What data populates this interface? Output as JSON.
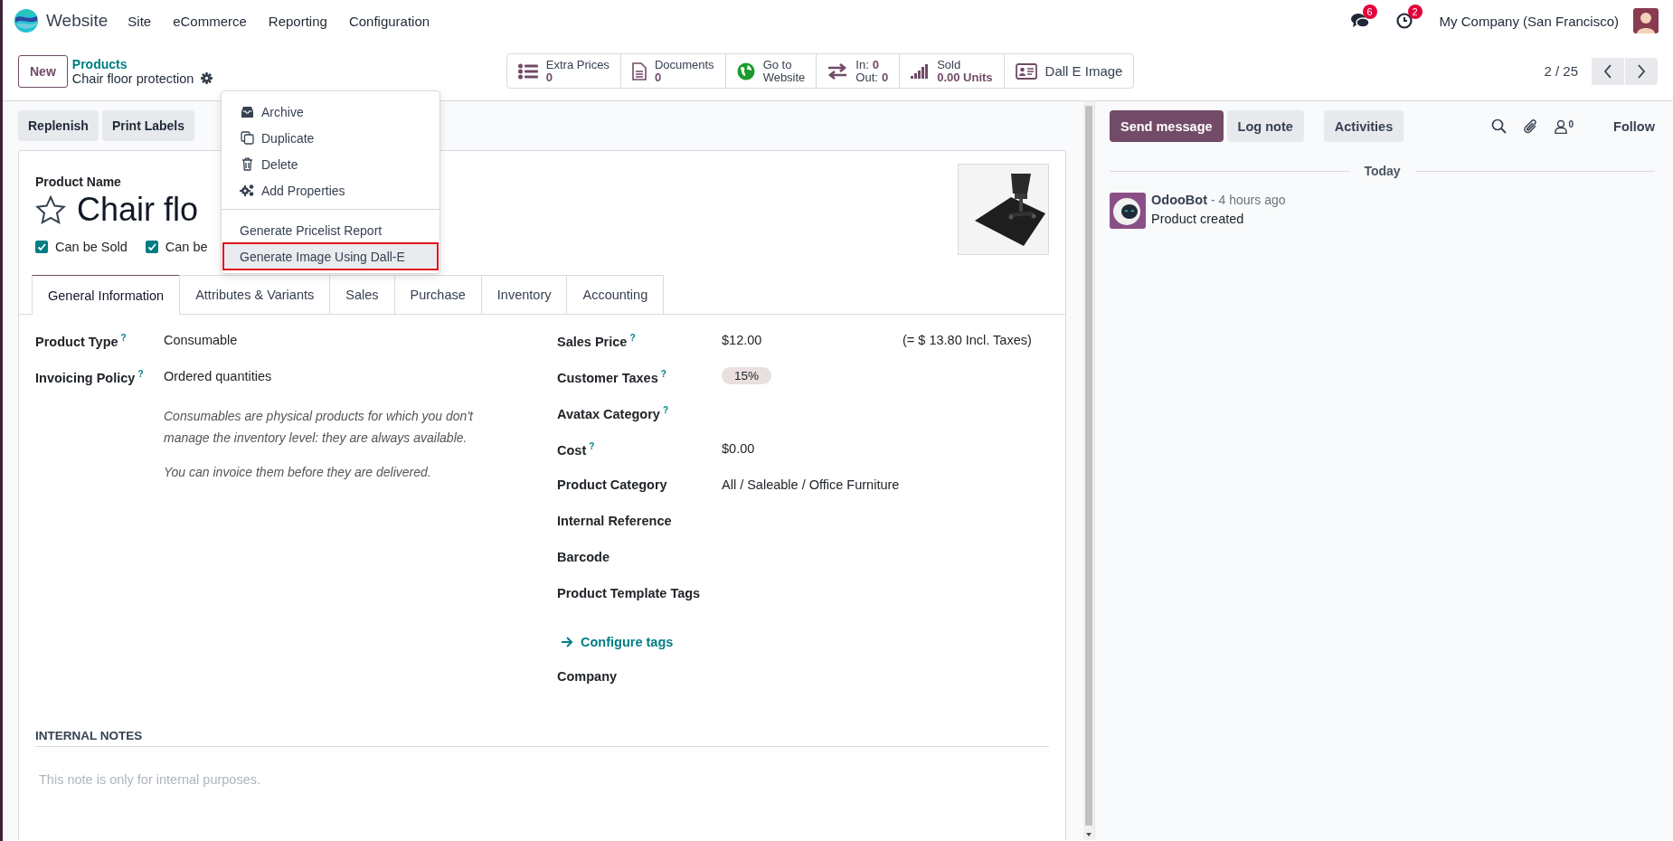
{
  "navbar": {
    "app_name": "Website",
    "menus": [
      "Site",
      "eCommerce",
      "Reporting",
      "Configuration"
    ],
    "messages_badge": "6",
    "activities_badge": "2",
    "company": "My Company (San Francisco)"
  },
  "control_panel": {
    "new_button": "New",
    "breadcrumb": "Products",
    "record_name": "Chair floor protection",
    "pager": "2 / 25"
  },
  "smart_buttons": [
    {
      "kind": "stat",
      "label": "Extra Prices",
      "value": "0"
    },
    {
      "kind": "stat",
      "label": "Documents",
      "value": "0"
    },
    {
      "kind": "text",
      "lines": [
        "Go to",
        "Website"
      ]
    },
    {
      "kind": "pairs",
      "rows": [
        {
          "label": "In:",
          "value": "0"
        },
        {
          "label": "Out:",
          "value": "0"
        }
      ]
    },
    {
      "kind": "stat",
      "label": "Sold",
      "value": "0.00 Units"
    },
    {
      "kind": "text",
      "lines": [
        "Dall E Image"
      ]
    }
  ],
  "gear_menu": {
    "sections": [
      [
        {
          "label": "Archive",
          "selected": false
        },
        {
          "label": "Duplicate",
          "selected": false
        },
        {
          "label": "Delete",
          "selected": false
        },
        {
          "label": "Add Properties",
          "selected": false
        }
      ],
      [
        {
          "label": "Generate Pricelist Report",
          "selected": false
        },
        {
          "label": "Generate Image Using Dall-E",
          "selected": true
        }
      ]
    ]
  },
  "action_buttons": [
    "Replenish",
    "Print Labels"
  ],
  "form": {
    "name_label": "Product Name",
    "name": "Chair flo",
    "favorite": false,
    "checkboxes": [
      {
        "label": "Can be Sold",
        "checked": true
      },
      {
        "label": "Can be",
        "checked": true
      }
    ],
    "tabs": [
      {
        "label": "General Information",
        "selected": true
      },
      {
        "label": "Attributes & Variants",
        "selected": false
      },
      {
        "label": "Sales",
        "selected": false
      },
      {
        "label": "Purchase",
        "selected": false
      },
      {
        "label": "Inventory",
        "selected": false
      },
      {
        "label": "Accounting",
        "selected": false
      }
    ],
    "left_fields": [
      {
        "label": "Product Type",
        "help": "?",
        "value": "Consumable"
      },
      {
        "label": "Invoicing Policy",
        "help": "?",
        "value": "Ordered quantities"
      }
    ],
    "left_notes": [
      "Consumables are physical products for which you don't manage the inventory level: they are always available.",
      "You can invoice them before they are delivered."
    ],
    "right_fields": [
      {
        "kind": "field",
        "label": "Sales Price",
        "help": "?",
        "value": "$12.00",
        "note": "(= $ 13.80 Incl. Taxes)"
      },
      {
        "kind": "tag",
        "label": "Customer Taxes",
        "help": "?",
        "tags": [
          "15%"
        ]
      },
      {
        "kind": "field",
        "label": "Avatax Category",
        "help": "?"
      },
      {
        "kind": "field",
        "label": "Cost",
        "help": "?",
        "value": "$0.00"
      },
      {
        "kind": "field",
        "label": "Product Category",
        "value": "All / Saleable / Office Furniture"
      },
      {
        "kind": "field",
        "label": "Internal Reference"
      },
      {
        "kind": "field",
        "label": "Barcode"
      },
      {
        "kind": "field",
        "label": "Product Template Tags"
      },
      {
        "kind": "link",
        "label": "Configure tags"
      },
      {
        "kind": "field",
        "label": "Company"
      }
    ],
    "notes_heading": "INTERNAL NOTES",
    "notes_placeholder": "This note is only for internal purposes."
  },
  "chatter": {
    "buttons": [
      {
        "label": "Send message",
        "kind": "primary"
      },
      {
        "label": "Log note",
        "kind": "secondary"
      },
      {
        "label": "Activities",
        "kind": "secondary"
      }
    ],
    "followers_count": "0",
    "follow": "Follow",
    "date_separator": "Today",
    "messages": [
      {
        "author": "OdooBot",
        "time": "- 4 hours ago",
        "body": "Product created"
      }
    ]
  }
}
